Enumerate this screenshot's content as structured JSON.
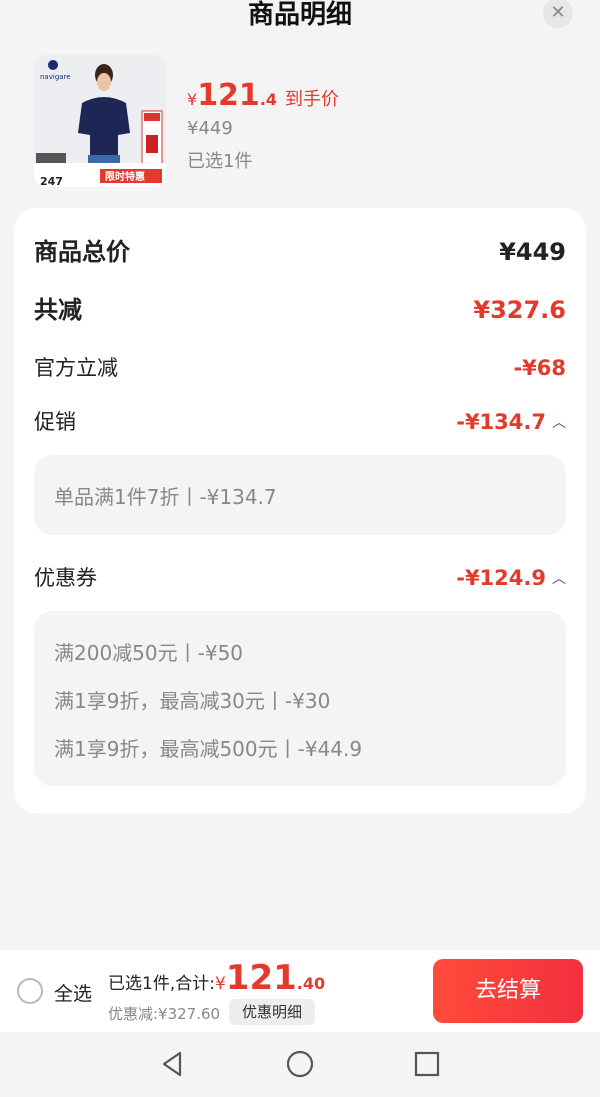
{
  "header": {
    "title": "商品明细",
    "close_icon": "close-icon"
  },
  "product": {
    "image_texts": {
      "brand": "navigare",
      "promo": "限时特惠",
      "number": "247"
    },
    "price_yen": "¥",
    "price_int": "121",
    "price_dec": ".4",
    "price_tag": "到手价",
    "original_price": "¥449",
    "selected_count": "已选1件"
  },
  "summary": {
    "total_label": "商品总价",
    "total_value": "¥449",
    "discount_label": "共减",
    "discount_value": "¥327.6",
    "official_label": "官方立减",
    "official_value": "-¥68",
    "promo_label": "促销",
    "promo_value": "-¥134.7",
    "promo_details": [
      "单品满1件7折丨-¥134.7"
    ],
    "coupon_label": "优惠券",
    "coupon_value": "-¥124.9",
    "coupon_details": [
      "满200减50元丨-¥50",
      "满1享9折，最高减30元丨-¥30",
      "满1享9折，最高减500元丨-¥44.9"
    ]
  },
  "bottom_bar": {
    "select_all_label": "全选",
    "total_prefix": "已选1件,合计:",
    "total_yen": "¥",
    "total_int": "121",
    "total_dec": ".40",
    "discount_note": "优惠减:¥327.60",
    "detail_chip": "优惠明细",
    "checkout_label": "去结算"
  },
  "colors": {
    "accent_red": "#e23a2d",
    "button_red": "#f2303e",
    "background": "#f4f4f4",
    "card": "#ffffff"
  },
  "nav": {
    "icons": [
      "back-icon",
      "home-icon",
      "recents-icon"
    ]
  }
}
